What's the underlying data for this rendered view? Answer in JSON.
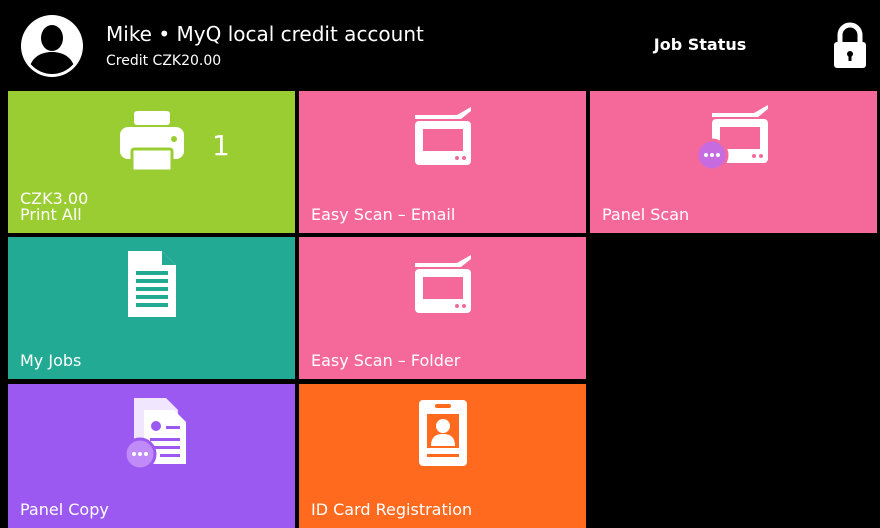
{
  "header": {
    "user_line": "Mike • MyQ local credit account",
    "credit_line": "Credit CZK20.00",
    "job_status_label": "Job Status",
    "avatar_icon": "user-avatar-icon",
    "lock_icon": "lock-icon"
  },
  "tiles": {
    "print_all": {
      "price": "CZK3.00",
      "label": "Print All",
      "count": "1",
      "color": "#9ACD32",
      "icon": "printer-icon"
    },
    "easy_scan_email": {
      "label": "Easy Scan – Email",
      "color": "#F5699A",
      "icon": "scanner-icon"
    },
    "panel_scan": {
      "label": "Panel Scan",
      "color": "#F5699A",
      "icon": "scanner-more-icon"
    },
    "my_jobs": {
      "label": "My Jobs",
      "color": "#23AA94",
      "icon": "document-icon"
    },
    "easy_scan_folder": {
      "label": "Easy Scan – Folder",
      "color": "#F5699A",
      "icon": "scanner-icon"
    },
    "panel_copy": {
      "label": "Panel Copy",
      "color": "#9B59F2",
      "icon": "copy-more-icon"
    },
    "id_card_registration": {
      "label": "ID Card Registration",
      "color": "#FF6A1F",
      "icon": "id-card-icon"
    }
  }
}
